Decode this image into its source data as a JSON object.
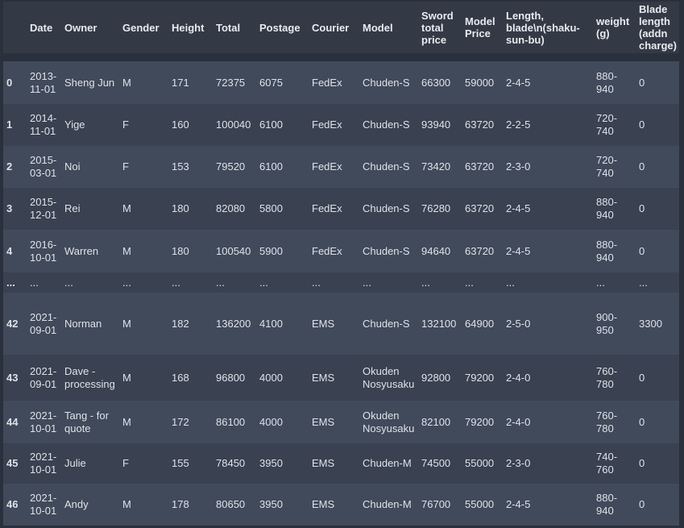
{
  "colors": {
    "page_bg": "#2a303c",
    "header_bg": "#333a46",
    "row_light": "#414a5b",
    "row_dark": "#3a4150",
    "text": "#dde1e7",
    "header_text": "#e7eaee"
  },
  "table": {
    "columns": [
      "",
      "Date",
      "Owner",
      "Gender",
      "Height",
      "Total",
      "Postage",
      "Courier",
      "Model",
      "Sword total price",
      "Model Price",
      "Length, blade\\n(shaku-sun-bu)",
      "weight (g)",
      "Blade length (addn charge)"
    ],
    "rows": [
      {
        "index": "0",
        "cells": [
          "2013-11-01",
          "Sheng Jun",
          "M",
          "171",
          "72375",
          "6075",
          "FedEx",
          "Chuden-S",
          "66300",
          "59000",
          "2-4-5",
          "880-940",
          "0"
        ]
      },
      {
        "index": "1",
        "cells": [
          "2014-11-01",
          "Yige",
          "F",
          "160",
          "100040",
          "6100",
          "FedEx",
          "Chuden-S",
          "93940",
          "63720",
          "2-2-5",
          "720-740",
          "0"
        ]
      },
      {
        "index": "2",
        "cells": [
          "2015-03-01",
          "Noi",
          "F",
          "153",
          "79520",
          "6100",
          "FedEx",
          "Chuden-S",
          "73420",
          "63720",
          "2-3-0",
          "720-740",
          "0"
        ]
      },
      {
        "index": "3",
        "cells": [
          "2015-12-01",
          "Rei",
          "M",
          "180",
          "82080",
          "5800",
          "FedEx",
          "Chuden-S",
          "76280",
          "63720",
          "2-4-5",
          "880-940",
          "0"
        ]
      },
      {
        "index": "4",
        "cells": [
          "2016-10-01",
          "Warren",
          "M",
          "180",
          "100540",
          "5900",
          "FedEx",
          "Chuden-S",
          "94640",
          "63720",
          "2-4-5",
          "880-940",
          "0"
        ]
      },
      {
        "index": "...",
        "cells": [
          "...",
          "...",
          "...",
          "...",
          "...",
          "...",
          "...",
          "...",
          "...",
          "...",
          "...",
          "...",
          "..."
        ]
      },
      {
        "index": "42",
        "cells": [
          "2021-09-01",
          "Norman",
          "M",
          "182",
          "136200",
          "4100",
          "EMS",
          "Chuden-S",
          "132100",
          "64900",
          "2-5-0",
          "900-950",
          "3300"
        ]
      },
      {
        "index": "43",
        "cells": [
          "2021-09-01",
          "Dave - processing",
          "M",
          "168",
          "96800",
          "4000",
          "EMS",
          "Okuden Nosyusaku",
          "92800",
          "79200",
          "2-4-0",
          "760-780",
          "0"
        ]
      },
      {
        "index": "44",
        "cells": [
          "2021-10-01",
          "Tang - for quote",
          "M",
          "172",
          "86100",
          "4000",
          "EMS",
          "Okuden Nosyusaku",
          "82100",
          "79200",
          "2-4-0",
          "760-780",
          "0"
        ]
      },
      {
        "index": "45",
        "cells": [
          "2021-10-01",
          "Julie",
          "F",
          "155",
          "78450",
          "3950",
          "EMS",
          "Chuden-M",
          "74500",
          "55000",
          "2-3-0",
          "740-760",
          "0"
        ]
      },
      {
        "index": "46",
        "cells": [
          "2021-10-01",
          "Andy",
          "M",
          "178",
          "80650",
          "3950",
          "EMS",
          "Chuden-M",
          "76700",
          "55000",
          "2-4-5",
          "880-940",
          "0"
        ]
      }
    ]
  }
}
